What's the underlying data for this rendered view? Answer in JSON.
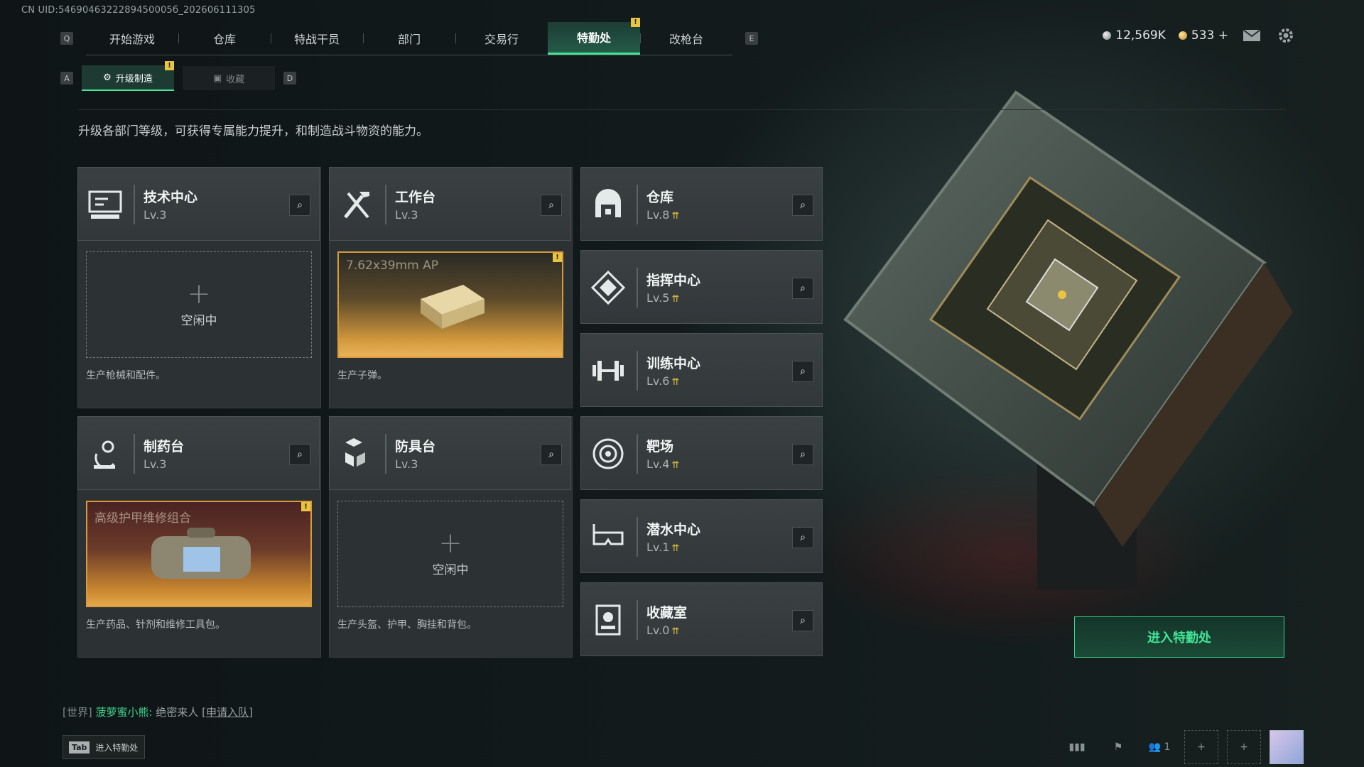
{
  "uid": "CN UID:5469046322289450005б_202606111305",
  "keys": {
    "left": "Q",
    "right": "E",
    "sub_left": "A",
    "sub_right": "D"
  },
  "nav": {
    "tabs": [
      "开始游戏",
      "仓库",
      "特战干员",
      "部门",
      "交易行",
      "特勤处",
      "改枪台"
    ],
    "active": "特勤处",
    "badge": "!"
  },
  "currency": {
    "silver": "12,569K",
    "gold": "533",
    "add": "+"
  },
  "subnav": {
    "upgrade": "升级制造",
    "collect": "收藏"
  },
  "description": "升级各部门等级，可获得专属能力提升，和制造战斗物资的能力。",
  "cards": {
    "tech": {
      "name": "技术中心",
      "level": "Lv.3",
      "slot": "空闲中",
      "plus": "+",
      "desc": "生产枪械和配件。"
    },
    "workbench": {
      "name": "工作台",
      "level": "Lv.3",
      "item": "7.62x39mm AP",
      "desc": "生产子弹。"
    },
    "pharmacy": {
      "name": "制药台",
      "level": "Lv.3",
      "item": "高级护甲维修组合",
      "desc": "生产药品、针剂和维修工具包。"
    },
    "armor": {
      "name": "防具台",
      "level": "Lv.3",
      "slot": "空闲中",
      "plus": "+",
      "desc": "生产头盔、护甲、胸挂和背包。"
    }
  },
  "right_cards": [
    {
      "name": "仓库",
      "level": "Lv.8"
    },
    {
      "name": "指挥中心",
      "level": "Lv.5"
    },
    {
      "name": "训练中心",
      "level": "Lv.6"
    },
    {
      "name": "靶场",
      "level": "Lv.4"
    },
    {
      "name": "潜水中心",
      "level": "Lv.1"
    },
    {
      "name": "收藏室",
      "level": "Lv.0"
    }
  ],
  "upgrade_glyph": "⇈",
  "enter_button": "进入特勤处",
  "chat": {
    "channel": "[世界]",
    "player": "菠萝蜜小熊:",
    "message": "绝密来人",
    "action": "[申请入队]"
  },
  "tab_hint": {
    "key": "Tab",
    "label": "进入特勤处"
  },
  "dock": {
    "friends_count": "1",
    "plus": "+"
  },
  "colors": {
    "accent": "#46e29a",
    "warning": "#e8c440",
    "craft_border": "#d99b3a",
    "panel": "#32373a"
  }
}
